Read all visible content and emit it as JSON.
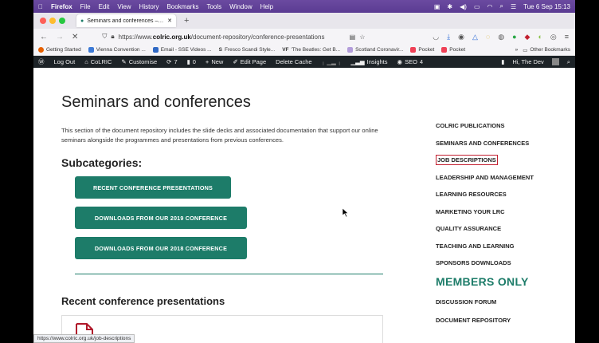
{
  "menubar": {
    "app": "Firefox",
    "items": [
      "File",
      "Edit",
      "View",
      "History",
      "Bookmarks",
      "Tools",
      "Window",
      "Help"
    ],
    "clock": "Tue 6 Sep 15:13"
  },
  "tab": {
    "title": "Seminars and conferences – Co"
  },
  "nav": {
    "url_prefix": "https://www.",
    "url_domain": "colric.org.uk",
    "url_path": "/document-repository/conference-presentations"
  },
  "bookmarks": {
    "items": [
      "Getting Started",
      "Vienna Convention ...",
      "Email - SSE Videos ...",
      "Fresco Scandi Style...",
      "'The Beatles: Get B...",
      "Scotland Coronavir...",
      "Pocket",
      "Pocket"
    ],
    "other": "Other Bookmarks"
  },
  "wpbar": {
    "logout": "Log Out",
    "site": "CoLRIC",
    "customise": "Customise",
    "updates": "7",
    "comments": "0",
    "new": "New",
    "edit": "Edit Page",
    "cache": "Delete Cache",
    "insights": "Insights",
    "seo": "SEO",
    "seo_count": "4",
    "greeting": "Hi, The Dev"
  },
  "page": {
    "title": "Seminars and conferences",
    "intro": "This section of the document repository includes the slide decks and associated documentation that support our online seminars alongside the programmes and presentations from previous conferences.",
    "subcategories_heading": "Subcategories:",
    "buttons": [
      "RECENT CONFERENCE PRESENTATIONS",
      "DOWNLOADS FROM OUR 2019 CONFERENCE",
      "DOWNLOADS FROM OUR 2018 CONFERENCE"
    ],
    "recent_heading": "Recent conference presentations"
  },
  "sidebar": {
    "items": [
      "COLRIC PUBLICATIONS",
      "SEMINARS AND CONFERENCES",
      "JOB DESCRIPTIONS",
      "LEADERSHIP AND MANAGEMENT",
      "LEARNING RESOURCES",
      "MARKETING YOUR LRC",
      "QUALITY ASSURANCE",
      "TEACHING AND LEARNING",
      "SPONSORS DOWNLOADS"
    ],
    "members_heading": "MEMBERS ONLY",
    "members_items": [
      "DISCUSSION FORUM",
      "DOCUMENT REPOSITORY"
    ]
  },
  "statusbar": {
    "url": "https://www.colric.org.uk/job-descriptions"
  },
  "colors": {
    "brand_green": "#1d7c69",
    "highlight_red": "#c21f2f",
    "wp_bar": "#1d2327"
  }
}
